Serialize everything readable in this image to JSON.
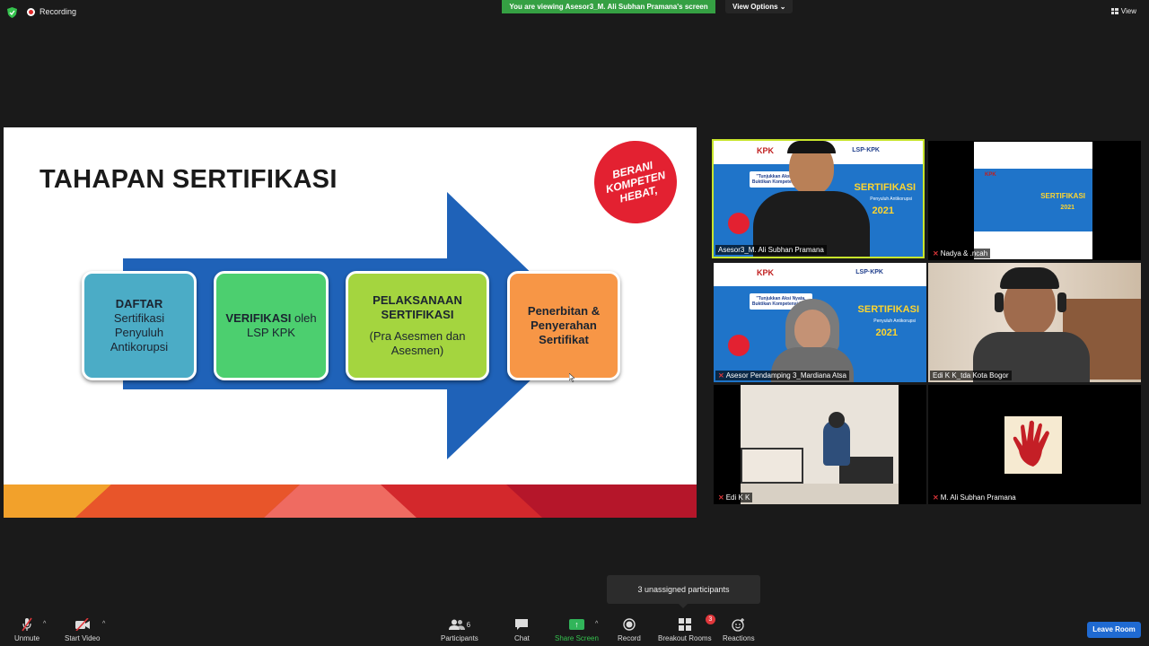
{
  "topbar": {
    "recording_label": "Recording",
    "viewing_banner": "You are viewing Asesor3_M. Ali Subhan Pramana's screen",
    "view_options_label": "View Options",
    "view_label": "View"
  },
  "slide": {
    "title": "TAHAPAN SERTIFIKASI",
    "badge_lines": [
      "BERANI",
      "KOMPETEN",
      "HEBAT,"
    ],
    "steps": [
      {
        "bold": "DAFTAR",
        "text": [
          "Sertifikasi",
          "Penyuluh",
          "Antikorupsi"
        ]
      },
      {
        "bold": "VERIFIKASI",
        "text_inline": "oleh",
        "text": [
          "LSP KPK"
        ]
      },
      {
        "bold_lines": [
          "PELAKSANAAN",
          "SERTIFIKASI"
        ],
        "text": [
          "(Pra Asesmen dan",
          "Asesmen)"
        ]
      },
      {
        "bold_lines": [
          "Penerbitan &",
          "Penyerahan",
          "Sertifikat"
        ]
      }
    ]
  },
  "banner": {
    "kpk": "KPK",
    "lsp": "LSP·KPK",
    "title": "SERTIFIKASI",
    "subtitle": "Penyuluh Antikorupsi",
    "year": "2021",
    "quote": "\"Tunjukkan Aksi Nyata, Buktikan Kompetensi Kita\""
  },
  "participants": [
    {
      "name": "Asesor3_M. Ali Subhan Pramana",
      "muted": false
    },
    {
      "name": "Nadya & .ncah",
      "muted": true
    },
    {
      "name": "Asesor Pendamping 3_Mardiana Atsa",
      "muted": true
    },
    {
      "name": "Edi K K_tda Kota Bogor",
      "muted": false
    },
    {
      "name": "Edi  K K",
      "muted": true
    },
    {
      "name": "M. Ali Subhan Pramana",
      "muted": true
    }
  ],
  "toolbar": {
    "unmute": "Unmute",
    "start_video": "Start Video",
    "participants": "Participants",
    "participants_count": "6",
    "chat": "Chat",
    "share_screen": "Share Screen",
    "record": "Record",
    "breakout_rooms": "Breakout Rooms",
    "breakout_count": "3",
    "reactions": "Reactions",
    "leave_room": "Leave Room"
  },
  "tooltip": "3 unassigned participants",
  "colors": {
    "active_speaker": "#c8e52c",
    "share_green": "#31b55a",
    "leave_blue": "#1f6ad2",
    "banner_blue": "#1f74c9"
  }
}
